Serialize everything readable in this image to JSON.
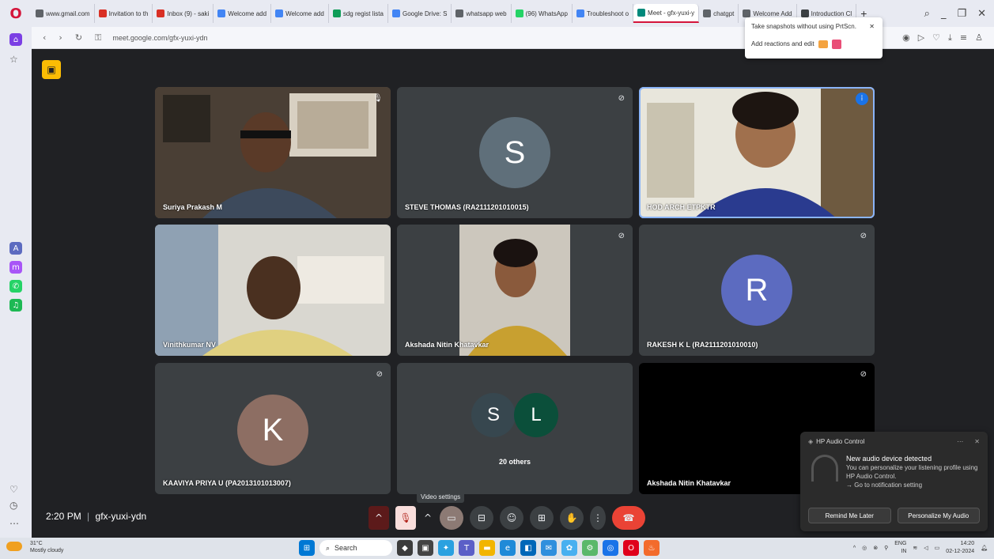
{
  "browser": {
    "tabs": [
      {
        "label": "www.gmail.com",
        "icon": "search-icon",
        "color": "#5f6368"
      },
      {
        "label": "Invitation to th",
        "icon": "gmail-icon",
        "color": "#d93025"
      },
      {
        "label": "Inbox (9) - saki",
        "icon": "gmail-icon",
        "color": "#d93025"
      },
      {
        "label": "Welcome add",
        "icon": "docs-icon",
        "color": "#4285f4"
      },
      {
        "label": "Welcome add",
        "icon": "docs-icon",
        "color": "#4285f4"
      },
      {
        "label": "sdg regist lista",
        "icon": "sheets-icon",
        "color": "#0f9d58"
      },
      {
        "label": "Google Drive: S",
        "icon": "google-icon",
        "color": "#4285f4"
      },
      {
        "label": "whatsapp web",
        "icon": "search-icon",
        "color": "#5f6368"
      },
      {
        "label": "(96) WhatsApp",
        "icon": "whatsapp-icon",
        "color": "#25d366"
      },
      {
        "label": "Troubleshoot o",
        "icon": "google-icon",
        "color": "#4285f4"
      },
      {
        "label": "Meet - gfx-yuxi-y",
        "icon": "meet-icon",
        "color": "#00897b",
        "active": true
      },
      {
        "label": "chatgpt",
        "icon": "search-icon",
        "color": "#5f6368"
      },
      {
        "label": "Welcome Add",
        "icon": "globe-icon",
        "color": "#5f6368"
      },
      {
        "label": "Introduction Cl",
        "icon": "page-icon",
        "color": "#3c4043"
      }
    ],
    "newtab": "+",
    "url": "meet.google.com/gfx-yuxi-ydn"
  },
  "snapshot_popup": {
    "line1": "Take snapshots without using PrtScn.",
    "line2": "Add reactions and edit"
  },
  "meet": {
    "participants": [
      {
        "name": "Suriya Prakash M",
        "type": "video"
      },
      {
        "name": "STEVE THOMAS (RA2111201010015)",
        "type": "avatar",
        "initial": "S",
        "color": "#5f6f7a"
      },
      {
        "name": "HOD ARCH ETPKTR",
        "type": "video"
      },
      {
        "name": "Vinithkumar NV",
        "type": "video"
      },
      {
        "name": "Akshada Nitin Khatavkar",
        "type": "video"
      },
      {
        "name": "RAKESH K L (RA2111201010010)",
        "type": "avatar",
        "initial": "R",
        "color": "#5c6bc0"
      },
      {
        "name": "KAAVIYA PRIYA U (PA2013101013007)",
        "type": "avatar",
        "initial": "K",
        "color": "#8d6e63"
      },
      {
        "name": "20 others",
        "type": "group",
        "initials": [
          "S",
          "L"
        ],
        "colors": [
          "#37474f",
          "#0b4f3a"
        ]
      },
      {
        "name": "Akshada Nitin Khatavkar",
        "type": "black"
      }
    ],
    "time": "2:20 PM",
    "meeting_code": "gfx-yuxi-ydn",
    "tooltip": "Video settings"
  },
  "hp_audio": {
    "title": "HP Audio Control",
    "heading": "New audio device detected",
    "body": "You can personalize your listening profile using HP Audio Control.",
    "link": "→ Go to notification setting",
    "btn_later": "Remind Me Later",
    "btn_personalize": "Personalize My Audio"
  },
  "taskbar": {
    "temp": "31°C",
    "weather": "Mostly cloudy",
    "search": "Search",
    "lang1": "ENG",
    "lang2": "IN",
    "time": "14:20",
    "date": "02-12-2024"
  }
}
